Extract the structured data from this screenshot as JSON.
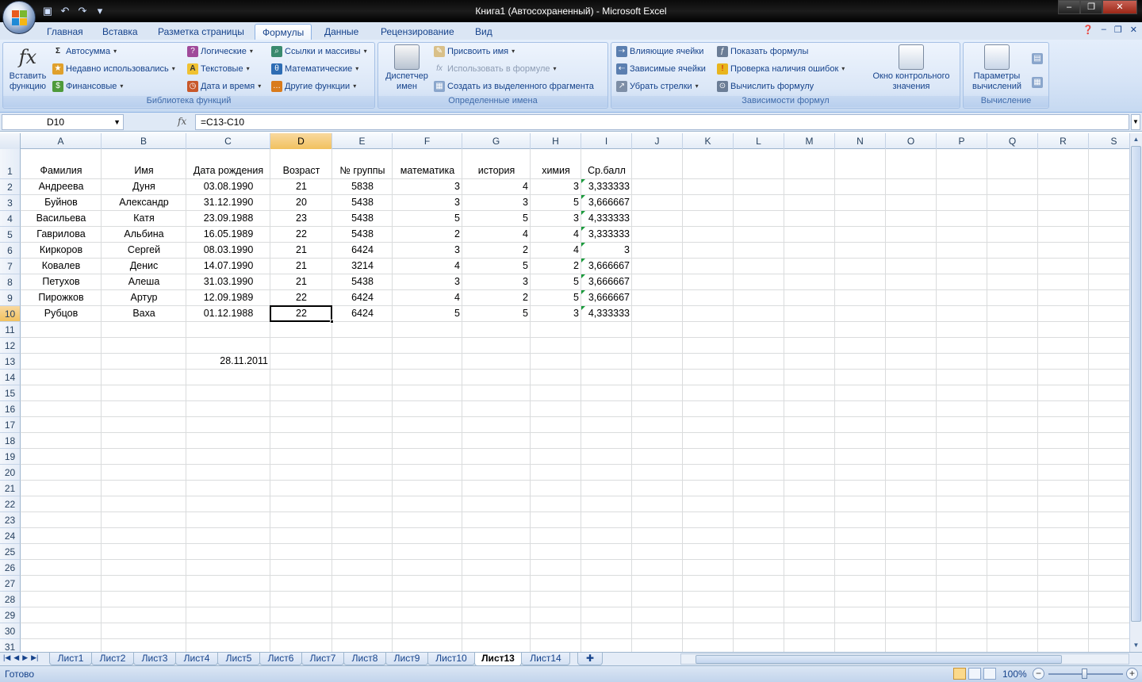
{
  "window": {
    "title": "Книга1 (Автосохраненный) - Microsoft Excel",
    "minimize": "–",
    "restore": "❐",
    "close": "✕"
  },
  "ribbon_tabs": [
    "Главная",
    "Вставка",
    "Разметка страницы",
    "Формулы",
    "Данные",
    "Рецензирование",
    "Вид"
  ],
  "active_tab": "Формулы",
  "ribbon": {
    "lib_group": "Библиотека функций",
    "insert_function": "Вставить функцию",
    "autosum": "Автосумма",
    "recent": "Недавно использовались",
    "financial": "Финансовые",
    "logical": "Логические",
    "text": "Текстовые",
    "datetime": "Дата и время",
    "lookup": "Ссылки и массивы",
    "math": "Математические",
    "other": "Другие функции",
    "names_group": "Определенные имена",
    "name_manager": "Диспетчер имен",
    "define_name": "Присвоить имя",
    "use_in_formula": "Использовать в формуле",
    "create_from_sel": "Создать из выделенного фрагмента",
    "audit_group": "Зависимости формул",
    "trace_precedents": "Влияющие ячейки",
    "trace_dependents": "Зависимые ячейки",
    "remove_arrows": "Убрать стрелки",
    "show_formulas": "Показать формулы",
    "error_checking": "Проверка наличия ошибок",
    "evaluate": "Вычислить формулу",
    "watch": "Окно контрольного значения",
    "calc_group": "Вычисление",
    "calc_options": "Параметры вычислений"
  },
  "formula_bar": {
    "name_box": "D10",
    "fx": "fx",
    "formula": "=C13-C10"
  },
  "columns": [
    "A",
    "B",
    "C",
    "D",
    "E",
    "F",
    "G",
    "H",
    "I",
    "J",
    "K",
    "L",
    "M",
    "N",
    "O",
    "P",
    "Q",
    "R",
    "S"
  ],
  "rows": [
    "1",
    "2",
    "3",
    "4",
    "5",
    "6",
    "7",
    "8",
    "9",
    "10",
    "11",
    "12",
    "13",
    "14",
    "15",
    "16",
    "17",
    "18",
    "19",
    "20",
    "21",
    "22",
    "23",
    "24",
    "25",
    "26",
    "27",
    "28",
    "29",
    "30",
    "31"
  ],
  "headers": [
    "Фамилия",
    "Имя",
    "Дата рождения",
    "Возраст",
    "№ группы",
    "математика",
    "история",
    "химия",
    "Ср.балл"
  ],
  "table": [
    [
      "Андреева",
      "Дуня",
      "03.08.1990",
      "21",
      "5838",
      "3",
      "4",
      "3",
      "3,333333"
    ],
    [
      "Буйнов",
      "Александр",
      "31.12.1990",
      "20",
      "5438",
      "3",
      "3",
      "5",
      "3,666667"
    ],
    [
      "Васильева",
      "Катя",
      "23.09.1988",
      "23",
      "5438",
      "5",
      "5",
      "3",
      "4,333333"
    ],
    [
      "Гаврилова",
      "Альбина",
      "16.05.1989",
      "22",
      "5438",
      "2",
      "4",
      "4",
      "3,333333"
    ],
    [
      "Киркоров",
      "Сергей",
      "08.03.1990",
      "21",
      "6424",
      "3",
      "2",
      "4",
      "3"
    ],
    [
      "Ковалев",
      "Денис",
      "14.07.1990",
      "21",
      "3214",
      "4",
      "5",
      "2",
      "3,666667"
    ],
    [
      "Петухов",
      "Алеша",
      "31.03.1990",
      "21",
      "5438",
      "3",
      "3",
      "5",
      "3,666667"
    ],
    [
      "Пирожков",
      "Артур",
      "12.09.1989",
      "22",
      "6424",
      "4",
      "2",
      "5",
      "3,666667"
    ],
    [
      "Рубцов",
      "Ваха",
      "01.12.1988",
      "22",
      "6424",
      "5",
      "5",
      "3",
      "4,333333"
    ]
  ],
  "c13": "28.11.2011",
  "sheets": [
    "Лист1",
    "Лист2",
    "Лист3",
    "Лист4",
    "Лист5",
    "Лист6",
    "Лист7",
    "Лист8",
    "Лист9",
    "Лист10",
    "Лист13",
    "Лист14"
  ],
  "active_sheet": "Лист13",
  "status": {
    "ready": "Готово",
    "zoom": "100%",
    "minus": "−",
    "plus": "+"
  }
}
